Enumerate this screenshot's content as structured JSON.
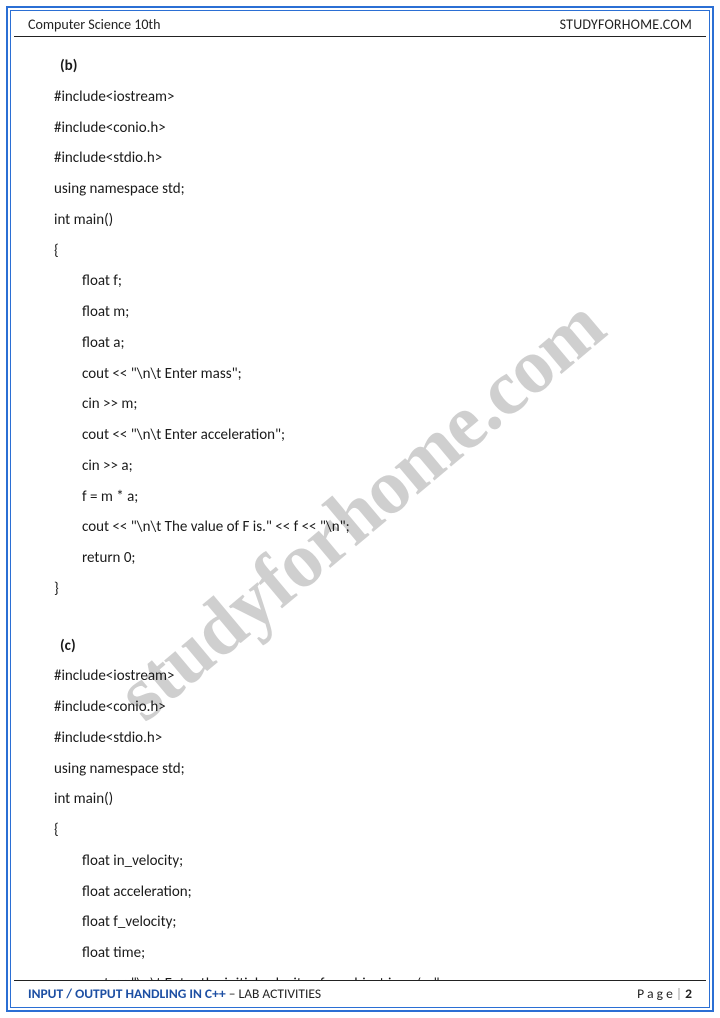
{
  "header": {
    "left": "Computer Science 10th",
    "right": "STUDYFORHOME.COM"
  },
  "watermark": "studyforhome.com",
  "sections": {
    "b": {
      "label": "(b)",
      "lines": [
        "#include<iostream>",
        "#include<conio.h>",
        "#include<stdio.h>",
        "using namespace std;",
        "int main()",
        "{"
      ],
      "indented": [
        "float f;",
        "float m;",
        "float a;",
        "cout << \"\\n\\t Enter mass\";",
        "cin >> m;",
        "cout << \"\\n\\t Enter acceleration\";",
        "cin >> a;",
        "f = m * a;",
        "cout << \"\\n\\t The value of F is.\" << f << \"\\n\";",
        "return 0;"
      ],
      "close": "}"
    },
    "c": {
      "label": "(c)",
      "lines": [
        "#include<iostream>",
        "#include<conio.h>",
        "#include<stdio.h>",
        "using namespace std;",
        "int main()",
        "{"
      ],
      "indented": [
        "float in_velocity;",
        "float acceleration;",
        "float f_velocity;",
        "float time;",
        "cout << \"\\n\\t Enter the initial velocity of an object in m/s=\";"
      ]
    }
  },
  "footer": {
    "title": "INPUT / OUTPUT HANDLING IN C++",
    "subtitle": " – LAB ACTIVITIES",
    "page_label": "P a g e ",
    "bar": "| ",
    "page_num": "2"
  }
}
